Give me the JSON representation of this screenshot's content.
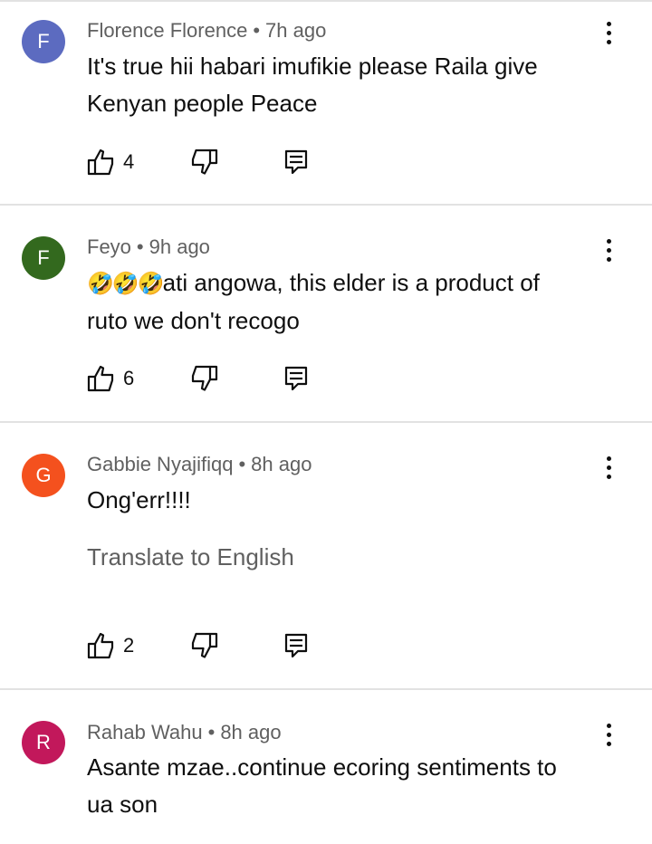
{
  "comments": [
    {
      "author": "Florence Florence",
      "time": "7h ago",
      "avatar_letter": "F",
      "avatar_color": "#5c6bc0",
      "text_lines": [
        "It's true hii habari imufikie please Raila give",
        "Kenyan people Peace"
      ],
      "likes": "4"
    },
    {
      "author": "Feyo",
      "time": "9h ago",
      "avatar_letter": "F",
      "avatar_color": "#33691e",
      "emojis": "🤣🤣🤣",
      "text_lines": [
        "ati angowa, this elder is a product of",
        "ruto we don't recogo"
      ],
      "likes": "6"
    },
    {
      "author": "Gabbie Nyajifiqq",
      "time": "8h ago",
      "avatar_letter": "G",
      "avatar_color": "#f4511e",
      "text_lines": [
        "Ong'err!!!!"
      ],
      "translate_label": "Translate to English",
      "likes": "2"
    },
    {
      "author": "Rahab Wahu",
      "time": "8h ago",
      "avatar_letter": "R",
      "avatar_color": "#c2185b",
      "text_lines": [
        "Asante mzae..continue ecoring sentiments to",
        "ua son"
      ]
    }
  ],
  "separator": "•",
  "icons": {
    "like": "thumb-up-icon",
    "dislike": "thumb-down-icon",
    "reply": "reply-icon",
    "menu": "more-vertical-icon"
  }
}
